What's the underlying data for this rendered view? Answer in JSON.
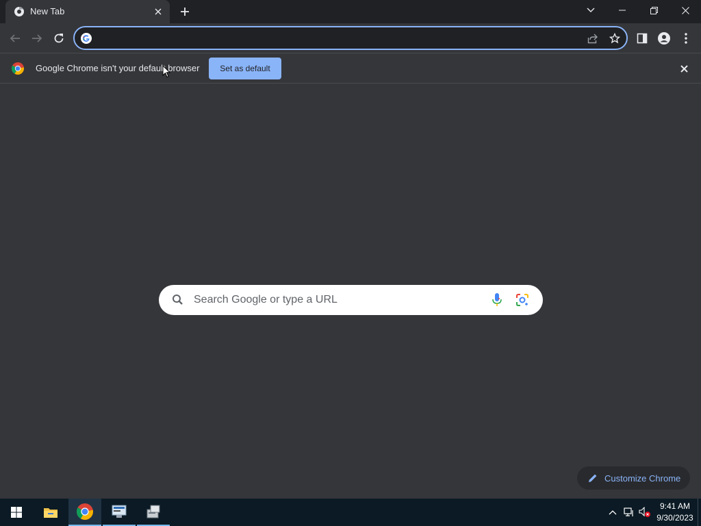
{
  "browser": {
    "tab": {
      "title": "New Tab",
      "favicon": "chrome-icon",
      "close_icon": "close-icon"
    },
    "new_tab_icon": "plus-icon",
    "window_controls": {
      "tab_search": "chevron-down-icon",
      "minimize": "minimize-icon",
      "restore": "restore-icon",
      "close": "close-icon"
    }
  },
  "toolbar": {
    "back": "arrow-left-icon",
    "forward": "arrow-right-icon",
    "reload": "reload-icon",
    "omnibox": {
      "value": "",
      "placeholder": "",
      "share_icon": "share-icon",
      "star_icon": "star-icon"
    },
    "side_panel": "side-panel-icon",
    "profile": "profile-icon",
    "menu": "kebab-menu-icon"
  },
  "infobar": {
    "message": "Google Chrome isn't your default browser",
    "button": "Set as default"
  },
  "ntp": {
    "search_placeholder": "Search Google or type a URL",
    "customize_label": "Customize Chrome"
  },
  "taskbar": {
    "apps": [
      "windows-start-icon",
      "file-explorer-icon",
      "chrome-icon",
      "network-app-icon",
      "server-app-icon"
    ],
    "tray": [
      "chevron-up-icon",
      "network-icon",
      "volume-muted-icon"
    ],
    "time": "9:41 AM",
    "date": "9/30/2023"
  },
  "colors": {
    "accent": "#8ab4f8",
    "page_bg": "#35363a",
    "frame_bg": "#202124",
    "taskbar_bg": "#0b1a24"
  }
}
